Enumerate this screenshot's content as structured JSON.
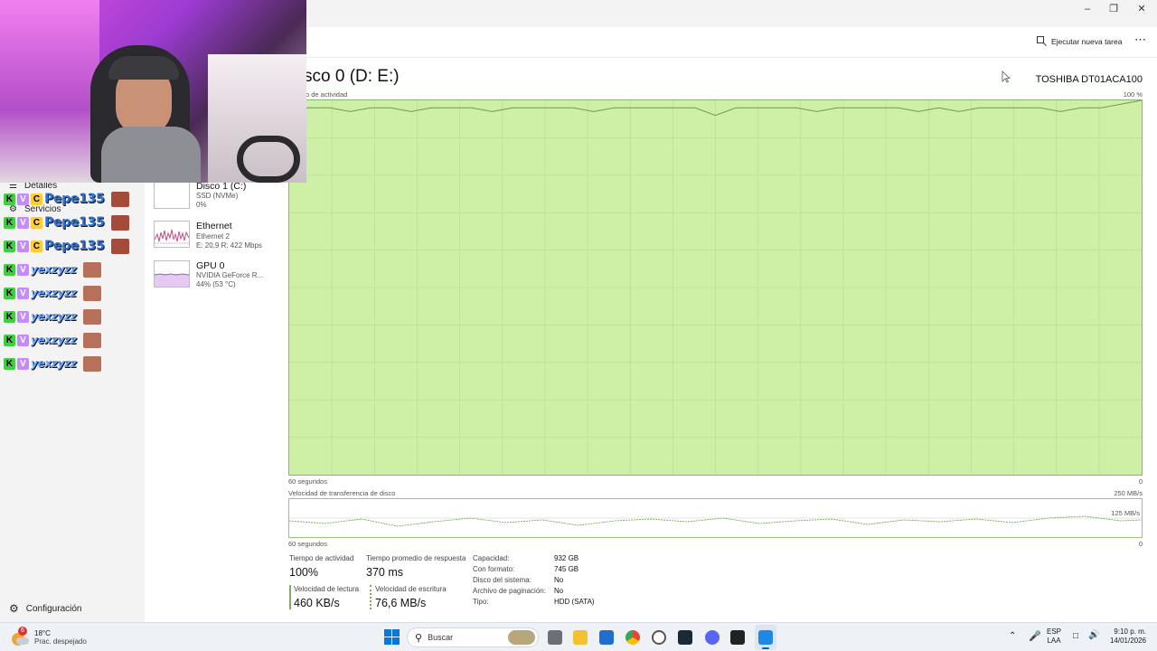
{
  "command_bar": {
    "new_task_label": "Ejecutar nueva tarea"
  },
  "nav": {
    "details": "Detalles",
    "services": "Servicios",
    "settings": "Configuración"
  },
  "devices": [
    {
      "name": "Disco 1 (C:)",
      "line1": "SSD (NVMe)",
      "line2": "0%"
    },
    {
      "name": "Ethernet",
      "line1": "Ethernet 2",
      "line2": "E: 20,9 R: 422 Mbps"
    },
    {
      "name": "GPU 0",
      "line1": "NVIDIA GeForce R...",
      "line2": "44% (53 °C)"
    }
  ],
  "chat": {
    "rows": [
      {
        "user": "Pepe135",
        "badges": [
          "K",
          "V",
          "C"
        ]
      },
      {
        "user": "Pepe135",
        "badges": [
          "K",
          "V",
          "C"
        ]
      },
      {
        "user": "Pepe135",
        "badges": [
          "K",
          "V",
          "C"
        ]
      },
      {
        "user": "yexzyzz",
        "badges": [
          "K",
          "V"
        ]
      },
      {
        "user": "yexzyzz",
        "badges": [
          "K",
          "V"
        ]
      },
      {
        "user": "yexzyzz",
        "badges": [
          "K",
          "V"
        ]
      },
      {
        "user": "yexzyzz",
        "badges": [
          "K",
          "V"
        ]
      },
      {
        "user": "yexzyzz",
        "badges": [
          "K",
          "V"
        ]
      }
    ]
  },
  "panel": {
    "title": "sco 0 (D: E:)",
    "model": "TOSHIBA DT01ACA100",
    "activity_label": "o de actividad",
    "activity_max": "100 %",
    "x_label": "60 segundos",
    "zero": "0",
    "transfer_label": "Velocidad de transferencia de disco",
    "transfer_max": "250 MB/s",
    "transfer_mid": "125 MB/s"
  },
  "stats": {
    "activity_time_label": "Tiempo de actividad",
    "activity_time": "100%",
    "avg_response_label": "Tiempo promedio de respuesta",
    "avg_response": "370 ms",
    "read_speed_label": "Velocidad de lectura",
    "read_speed": "460 KB/s",
    "write_speed_label": "Velocidad de escritura",
    "write_speed": "76,6 MB/s"
  },
  "properties": [
    {
      "label": "Capacidad:",
      "value": "932 GB"
    },
    {
      "label": "Con formato:",
      "value": "745 GB"
    },
    {
      "label": "Disco del sistema:",
      "value": "No"
    },
    {
      "label": "Archivo de paginación:",
      "value": "No"
    },
    {
      "label": "Tipo:",
      "value": "HDD (SATA)"
    }
  ],
  "taskbar": {
    "weather_temp": "18°C",
    "weather_desc": "Prac. despejado",
    "weather_badge": "6",
    "search_placeholder": "Buscar",
    "lang_top": "ESP",
    "lang_bottom": "LAA",
    "time": "9:10 p. m.",
    "date": "14/01/2026"
  },
  "chart_data": {
    "type": "area",
    "title": "",
    "series": [
      {
        "values": [
          98,
          98,
          98,
          97,
          98,
          98,
          97,
          98,
          98,
          98,
          97,
          98,
          98,
          98,
          98,
          97,
          98,
          98,
          98,
          98,
          98,
          96,
          98,
          98,
          98,
          98,
          97,
          98,
          98,
          98,
          98,
          97,
          98,
          97,
          98,
          98,
          98,
          98,
          97,
          98,
          98,
          99,
          100
        ]
      }
    ],
    "xlabel": "60 segundos",
    "ylim": [
      0,
      100
    ]
  },
  "colors": {
    "chart_fill": "#cdefa6",
    "chart_line": "#6f9d4a",
    "accent": "#0067c0"
  }
}
